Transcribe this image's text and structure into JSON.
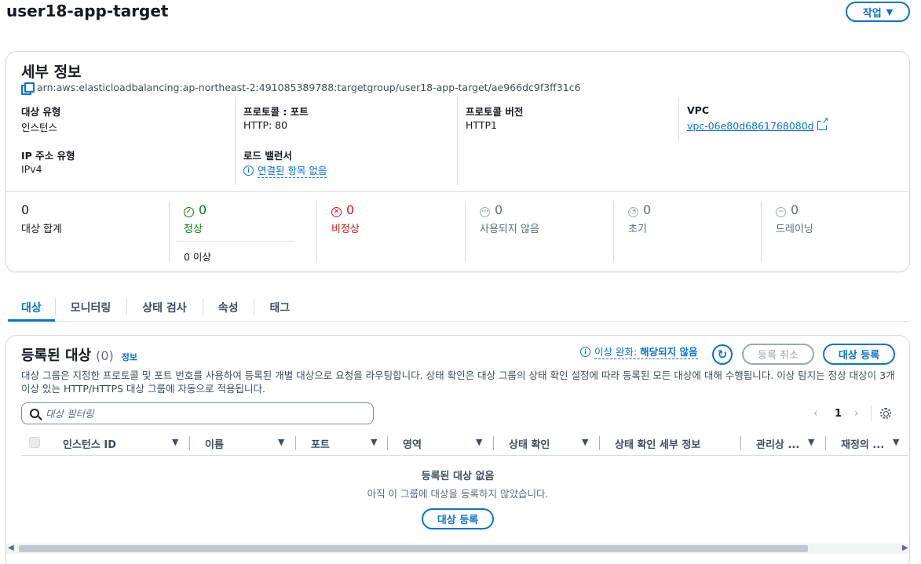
{
  "page": {
    "title": "user18-app-target",
    "action_label": "작업"
  },
  "details": {
    "title": "세부 정보",
    "arn": "arn:aws:elasticloadbalancing:ap-northeast-2:491085389788:targetgroup/user18-app-target/ae966dc9f3ff31c6",
    "target_type_label": "대상 유형",
    "target_type_value": "인스턴스",
    "protocol_port_label": "프로토콜 : 포트",
    "protocol_port_value": "HTTP: 80",
    "protocol_version_label": "프로토콜 버전",
    "protocol_version_value": "HTTP1",
    "vpc_label": "VPC",
    "vpc_value": "vpc-06e80d6861768080d",
    "ip_type_label": "IP 주소 유형",
    "ip_type_value": "IPv4",
    "lb_label": "로드 밸런서",
    "lb_value": "연결된 항목 없음"
  },
  "stats": {
    "total": {
      "num": "0",
      "label": "대상 합계"
    },
    "healthy": {
      "num": "0",
      "label": "정상",
      "sub": "0 이상"
    },
    "unhealthy": {
      "num": "0",
      "label": "비정상"
    },
    "unused": {
      "num": "0",
      "label": "사용되지 않음"
    },
    "initial": {
      "num": "0",
      "label": "초기"
    },
    "draining": {
      "num": "0",
      "label": "드레이닝"
    }
  },
  "colors": {
    "accent": "#0972d3",
    "healthy": "#037f0c",
    "unhealthy": "#d91515",
    "muted": "#5f6b7a"
  },
  "tabs": [
    {
      "label": "대상"
    },
    {
      "label": "모니터링"
    },
    {
      "label": "상태 검사"
    },
    {
      "label": "속성"
    },
    {
      "label": "태그"
    }
  ],
  "targets": {
    "title": "등록된 대상",
    "count": "(0)",
    "info": "정보",
    "anomaly_prefix": "이상 완화: ",
    "anomaly_value": "해당되지 않음",
    "deregister_label": "등록 취소",
    "register_label": "대상 등록",
    "description": "대상 그룹은 지정한 프로토콜 및 포트 번호를 사용하여 등록된 개별 대상으로 요청을 라우팅합니다. 상태 확인은 대상 그룹의 상태 확인 설정에 따라 등록된 모든 대상에 대해 수행됩니다. 이상 탐지는 정상 대상이 3개 이상 있는 HTTP/HTTPS 대상 그룹에 자동으로 적용됩니다.",
    "filter_placeholder": "대상 필터링",
    "page_number": "1",
    "columns": [
      "인스턴스 ID",
      "이름",
      "포트",
      "영역",
      "상태 확인",
      "상태 확인 세부 정보",
      "관리상 ...",
      "재정의 ..."
    ],
    "empty_title": "등록된 대상 없음",
    "empty_sub": "아직 이 그룹에 대상을 등록하지 않았습니다.",
    "empty_register_label": "대상 등록"
  },
  "icons": [
    "copy-icon",
    "external-link-icon",
    "info-icon",
    "check-circle-icon",
    "x-circle-icon",
    "minus-circle-icon",
    "clock-icon",
    "refresh-icon",
    "search-icon",
    "gear-icon",
    "chevron-left-icon",
    "chevron-right-icon",
    "caret-down-icon"
  ]
}
